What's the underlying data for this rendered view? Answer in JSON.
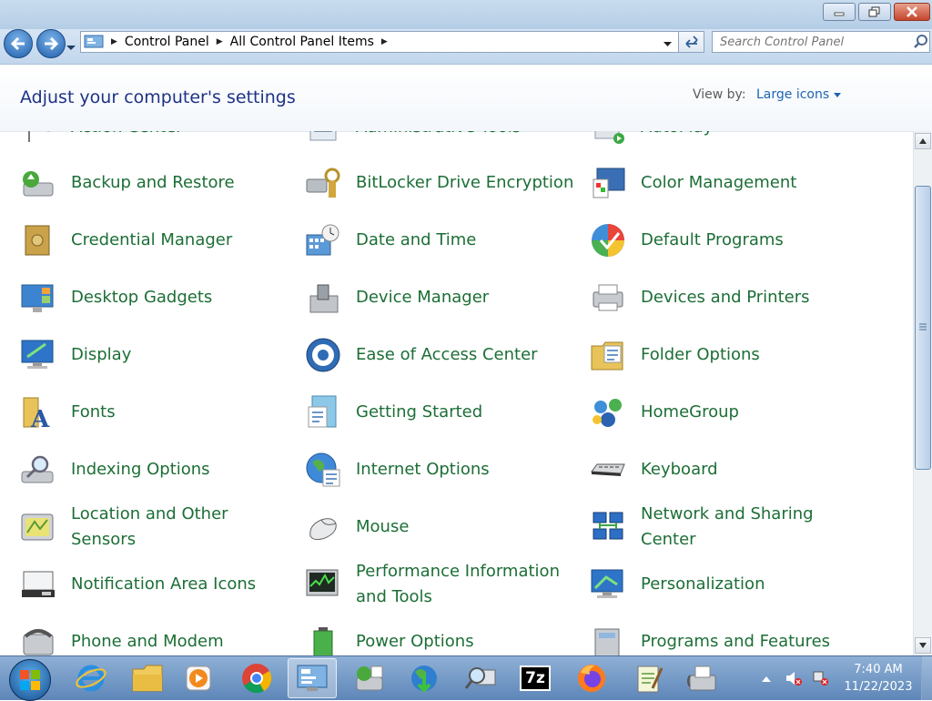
{
  "breadcrumb": [
    "Control Panel",
    "All Control Panel Items"
  ],
  "search": {
    "placeholder": "Search Control Panel"
  },
  "header": {
    "title": "Adjust your computer's settings",
    "view_by_label": "View by:",
    "view_by_value": "Large icons"
  },
  "items": {
    "r0": [
      "Action Center",
      "Administrative Tools",
      "AutoPlay"
    ],
    "r1": [
      "Backup and Restore",
      "BitLocker Drive Encryption",
      "Color Management"
    ],
    "r2": [
      "Credential Manager",
      "Date and Time",
      "Default Programs"
    ],
    "r3": [
      "Desktop Gadgets",
      "Device Manager",
      "Devices and Printers"
    ],
    "r4": [
      "Display",
      "Ease of Access Center",
      "Folder Options"
    ],
    "r5": [
      "Fonts",
      "Getting Started",
      "HomeGroup"
    ],
    "r6": [
      "Indexing Options",
      "Internet Options",
      "Keyboard"
    ],
    "r7a": [
      "Location and Other",
      "Mouse",
      "Network and Sharing"
    ],
    "r7b": [
      "Sensors",
      "Center"
    ],
    "r8a": [
      "Notification Area Icons",
      "Performance Information",
      "Personalization"
    ],
    "r8b": [
      "and Tools"
    ],
    "r9": [
      "Phone and Modem",
      "Power Options",
      "Programs and Features"
    ]
  },
  "taskbar": {
    "time": "7:40 AM",
    "date": "11/22/2023",
    "sevenzip_label": "7z"
  },
  "colors": {
    "link": "#1c6e36",
    "title": "#1e3287",
    "accent": "#1e64b4"
  }
}
